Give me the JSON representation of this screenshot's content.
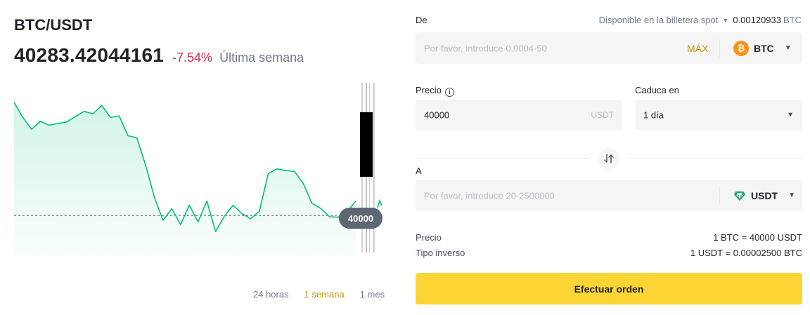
{
  "pair": {
    "title": "BTC/USDT",
    "price": "40283.42044161",
    "change": "-7.54%",
    "period": "Última semana",
    "change_color": "#cf304a"
  },
  "chart": {
    "tag": "40000",
    "line_color": "#02c076",
    "dashed_level": 40000
  },
  "chart_data": {
    "type": "area",
    "title": "",
    "xlabel": "",
    "ylabel": "",
    "reference_line": 40000,
    "series": [
      {
        "values": [
          43520,
          43050,
          42680,
          42930,
          42810,
          42860,
          42910,
          43080,
          43240,
          43160,
          43420,
          43050,
          43100,
          42480,
          42420,
          41580,
          40580,
          39850,
          40210,
          39720,
          40320,
          39800,
          40450,
          39500,
          39980,
          40320,
          40060,
          39900,
          40130,
          41300,
          41450,
          41400,
          41370,
          41000,
          40380,
          40220,
          39960,
          39950,
          40100,
          40450
        ]
      }
    ]
  },
  "ranges": [
    "24 horas",
    "1 semana",
    "1 mes"
  ],
  "ranges_active": "1 semana",
  "form": {
    "from_label": "De",
    "available_label": "Disponible en la billetera spot",
    "available_amount": "0.00120933",
    "available_currency": "BTC",
    "from_placeholder": "Por favor, introduce 0.0004-50",
    "max_label": "MÁX",
    "from_coin": "BTC",
    "price_label": "Precio",
    "price_value": "40000",
    "price_unit": "USDT",
    "expires_label": "Caduca en",
    "expires_value": "1 día",
    "to_label": "A",
    "to_placeholder": "Por favor, introduce 20-2500000",
    "to_coin": "USDT"
  },
  "summary": {
    "price_label": "Precio",
    "price_value": "1 BTC = 40000 USDT",
    "inverse_label": "Tipo inverso",
    "inverse_value": "1 USDT = 0.00002500 BTC"
  },
  "submit_label": "Efectuar orden",
  "colors": {
    "accent": "#fcd535",
    "gold": "#c99400",
    "positive": "#02c076",
    "negative": "#cf304a"
  }
}
